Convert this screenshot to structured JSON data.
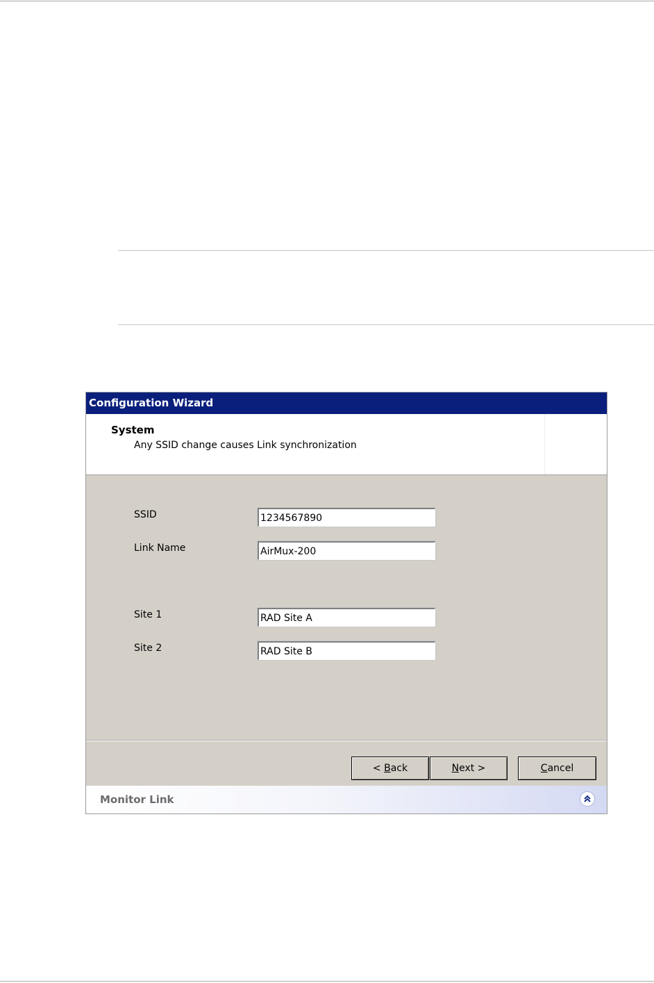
{
  "wizard": {
    "title": "Configuration Wizard",
    "header": {
      "title": "System",
      "subtitle": "Any SSID change causes Link synchronization"
    },
    "fields": {
      "ssid": {
        "label": "SSID",
        "value": "1234567890"
      },
      "link_name": {
        "label": "Link Name",
        "value": "AirMux-200"
      },
      "site1": {
        "label": "Site 1",
        "value": "RAD Site A"
      },
      "site2": {
        "label": "Site 2",
        "value": "RAD Site B"
      }
    },
    "buttons": {
      "back": {
        "prefix": "< ",
        "accel": "B",
        "rest": "ack"
      },
      "next": {
        "accel": "N",
        "rest": "ext >"
      },
      "cancel": {
        "accel": "C",
        "rest": "ancel"
      }
    },
    "monitor_bar": {
      "label": "Monitor Link",
      "icon": "double-chevron-up-icon"
    }
  }
}
